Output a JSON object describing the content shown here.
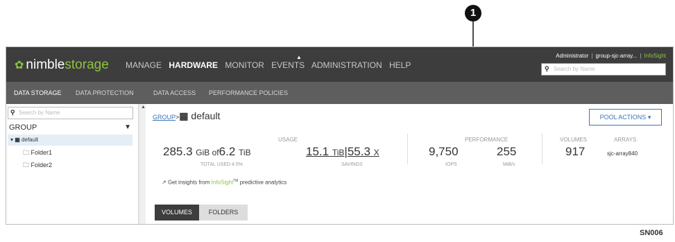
{
  "callout": {
    "number": "1"
  },
  "figure_id": "SN006",
  "header": {
    "logo_part1": "nimble",
    "logo_part2": "storage",
    "nav": [
      "MANAGE",
      "HARDWARE",
      "MONITOR",
      "EVENTS",
      "ADMINISTRATION",
      "HELP"
    ],
    "user": "Administrator",
    "group": "group-sjc-array...",
    "infosight": "InfoSight",
    "search_placeholder": "Search by Name"
  },
  "subnav": [
    "DATA STORAGE",
    "DATA PROTECTION",
    "DATA ACCESS",
    "PERFORMANCE POLICIES"
  ],
  "sidebar": {
    "search_placeholder": "Search by Name",
    "group_header": "GROUP",
    "tree_root": "default",
    "folders": [
      "Folder1",
      "Folder2"
    ]
  },
  "content": {
    "breadcrumb_group": "GROUP",
    "breadcrumb_sep": ">",
    "title": "default",
    "pool_actions": "POOL ACTIONS",
    "usage": {
      "label": "USAGE",
      "used": "285.3",
      "used_unit": "GiB of",
      "total": "6.2",
      "total_unit": "TiB",
      "used_pct": "TOTAL USED 4.5%",
      "savings_val1": "15.1",
      "savings_unit1": "TiB",
      "savings_val2": "55.3",
      "savings_unit2": "X",
      "savings_label": "SAVINGS"
    },
    "performance": {
      "label": "PERFORMANCE",
      "iops": "9,750",
      "iops_label": "IOPS",
      "mbps": "255",
      "mbps_label": "MiB/s"
    },
    "volumes": {
      "label": "VOLUMES",
      "value": "917"
    },
    "arrays": {
      "label": "ARRAYS",
      "value": "sjc-array840"
    },
    "insights_prefix": "Get insights from",
    "insights_link": "InfoSight",
    "insights_tm": "TM",
    "insights_suffix": "predictive analytics",
    "tabs": [
      "VOLUMES",
      "FOLDERS"
    ]
  },
  "colors": {
    "accent_green": "#8bc53f",
    "link_blue": "#3a73b6",
    "header_bg": "#3d3d3d",
    "subnav_bg": "#5e5e5e"
  }
}
